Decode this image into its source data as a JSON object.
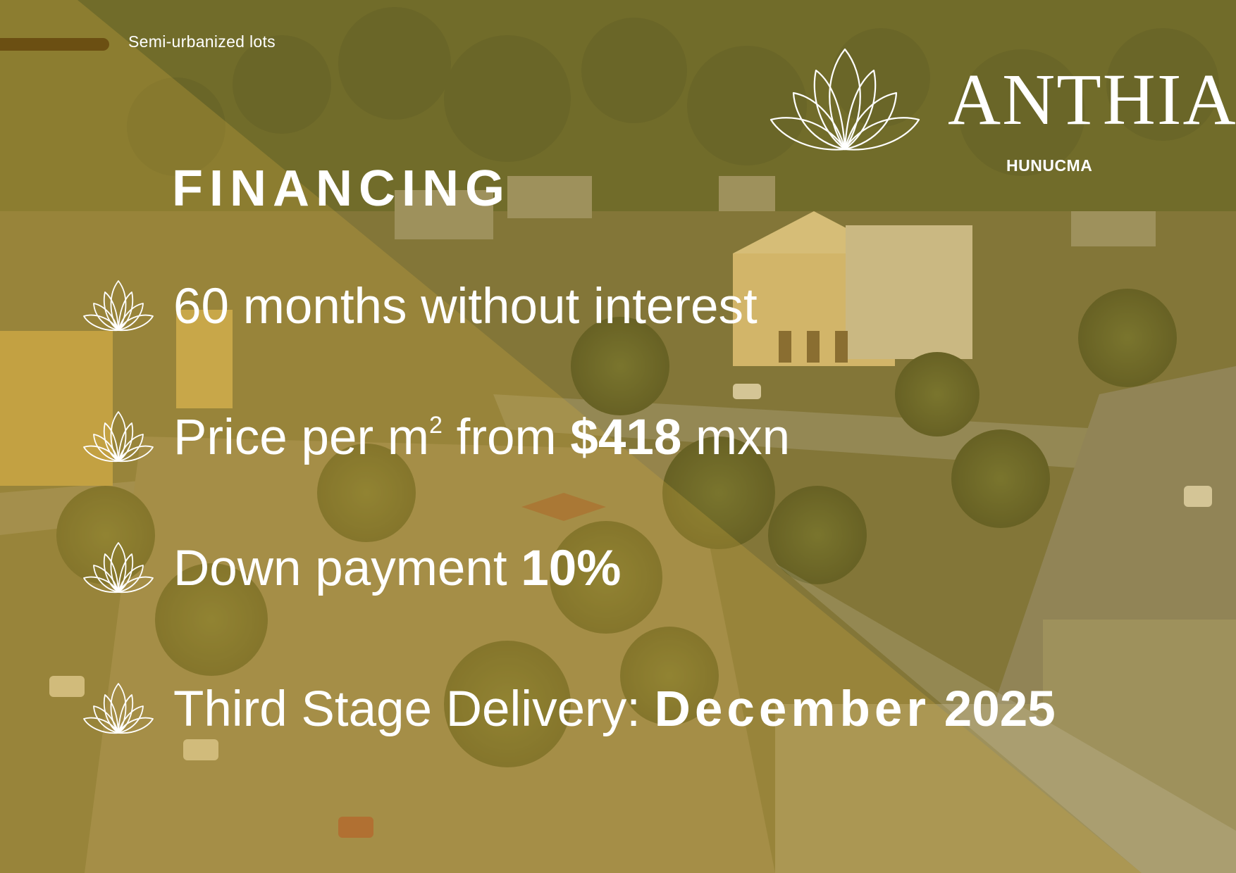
{
  "tagline": "Semi-urbanized lots",
  "logo": {
    "wordmark": "ANTHIA",
    "subtitle": "HUNUCMA",
    "icon": "lotus-icon"
  },
  "heading": "FINANCING",
  "bullets": [
    {
      "icon": "lotus-icon",
      "text": "60 months without interest"
    },
    {
      "icon": "lotus-icon",
      "pre": "Price per m",
      "sup": "2",
      "mid": " from ",
      "bold": "$418",
      "post": " mxn"
    },
    {
      "icon": "lotus-icon",
      "pre": "Down payment ",
      "bold": "10%"
    },
    {
      "icon": "lotus-icon",
      "pre": "Third Stage Delivery: ",
      "bold": "December",
      "post": " 2025"
    }
  ],
  "colors": {
    "accent_bar": "#6b4f12",
    "text": "#ffffff",
    "overlay_tint": "#c9a640"
  }
}
